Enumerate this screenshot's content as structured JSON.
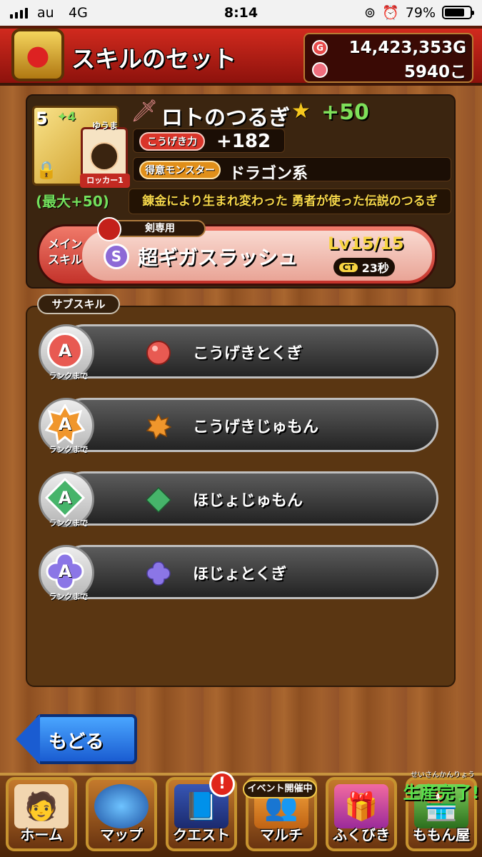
{
  "status": {
    "carrier": "au",
    "network": "4G",
    "time": "8:14",
    "battery": "79%"
  },
  "header": {
    "title": "スキルのセット",
    "gold": "14,423,353G",
    "gems": "5940こ",
    "gold_icon": "G"
  },
  "weapon": {
    "level": "5",
    "plus_level": "4",
    "owner": "ゆうま",
    "locker": "ロッカー1",
    "max_plus": "(最大+50)",
    "name": "ロトのつるぎ",
    "star": "★",
    "refine": "+50",
    "attack_label": "こうげき力",
    "attack_value": "+182",
    "favorite_label": "得意モンスター",
    "favorite_value": "ドラゴン系",
    "description": "錬金により生まれ変わった 勇者が使った伝説のつるぎ"
  },
  "main_skill": {
    "label": "メイン\nスキル",
    "restriction": "剣専用",
    "rank_icon": "S",
    "name": "超ギガスラッシュ",
    "level": "Lv15/15",
    "ct_label": "CT",
    "ct_value": "23秒"
  },
  "sub_skills": {
    "label": "サブスキル",
    "items": [
      {
        "rank": "A",
        "rank_caption": "ランクまで",
        "name": "こうげきとくぎ",
        "color": "#e85a52",
        "shape": "circle"
      },
      {
        "rank": "A",
        "rank_caption": "ランクまで",
        "name": "こうげきじゅもん",
        "color": "#f0962c",
        "shape": "star"
      },
      {
        "rank": "A",
        "rank_caption": "ランクまで",
        "name": "ほじょじゅもん",
        "color": "#46b46a",
        "shape": "diamond"
      },
      {
        "rank": "A",
        "rank_caption": "ランクまで",
        "name": "ほじょとくぎ",
        "color": "#8b76e6",
        "shape": "flower"
      }
    ]
  },
  "back_button": "もどる",
  "nav": {
    "items": [
      "ホーム",
      "マップ",
      "クエスト",
      "マルチ",
      "ふくびき",
      "ももん屋"
    ],
    "quest_badge": "!",
    "event_label": "イベント開催中",
    "production_caption": "せいさんかんりょう",
    "production_label": "生産完了!"
  }
}
